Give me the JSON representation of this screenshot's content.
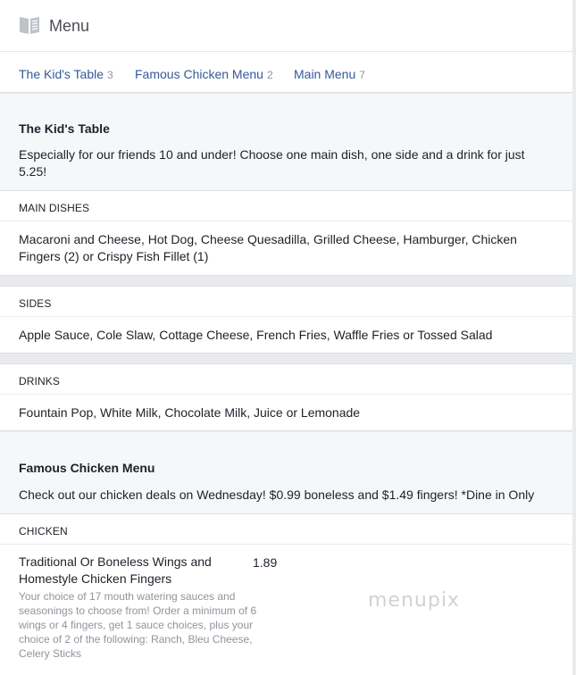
{
  "header": {
    "title": "Menu",
    "icon": "book-icon"
  },
  "tabs": [
    {
      "label": "The Kid's Table",
      "count": "3"
    },
    {
      "label": "Famous Chicken Menu",
      "count": "2"
    },
    {
      "label": "Main Menu",
      "count": "7"
    }
  ],
  "kids": {
    "title": "The Kid's Table",
    "description": "Especially for our friends 10 and under! Choose one main dish, one side and a drink for just 5.25!",
    "categories": [
      {
        "name": "MAIN DISHES",
        "items": "Macaroni and Cheese, Hot Dog, Cheese Quesadilla, Grilled Cheese, Hamburger, Chicken Fingers (2) or Crispy Fish Fillet (1)"
      },
      {
        "name": "SIDES",
        "items": "Apple Sauce, Cole Slaw, Cottage Cheese, French Fries, Waffle Fries or Tossed Salad"
      },
      {
        "name": "DRINKS",
        "items": "Fountain Pop, White Milk, Chocolate Milk, Juice or Lemonade"
      }
    ]
  },
  "chicken": {
    "title": "Famous Chicken Menu",
    "description": "Check out our chicken deals on Wednesday! $0.99 boneless and $1.49 fingers! *Dine in Only",
    "category": "CHICKEN",
    "item": {
      "name": "Traditional Or Boneless Wings and Homestyle Chicken Fingers",
      "price": "1.89",
      "description": "Your choice of 17 mouth watering sauces and seasonings to choose from! Order a minimum of 6 wings or 4 fingers, get 1 sauce choices, plus your choice of 2 of the following: Ranch, Bleu Cheese, Celery Sticks"
    }
  },
  "watermark": "menupix"
}
